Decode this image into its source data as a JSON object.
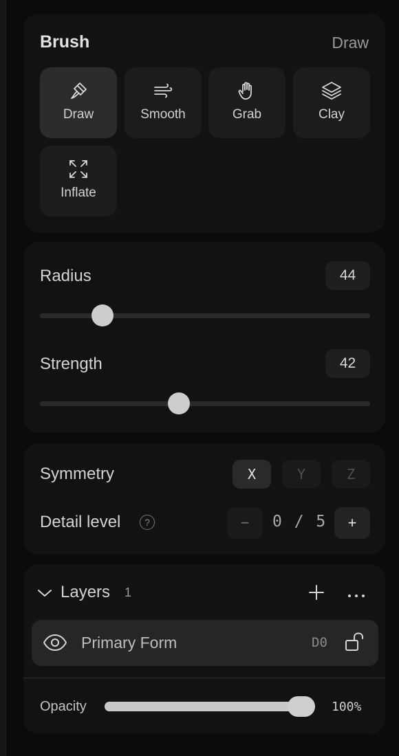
{
  "brush": {
    "title": "Brush",
    "mode": "Draw",
    "tools": [
      {
        "label": "Draw",
        "icon": "brush-icon",
        "active": true
      },
      {
        "label": "Smooth",
        "icon": "wind-icon",
        "active": false
      },
      {
        "label": "Grab",
        "icon": "hand-icon",
        "active": false
      },
      {
        "label": "Clay",
        "icon": "layers-icon",
        "active": false
      },
      {
        "label": "Inflate",
        "icon": "expand-icon",
        "active": false
      }
    ]
  },
  "sliders": {
    "radius": {
      "label": "Radius",
      "value": "44",
      "fraction": 0.19
    },
    "strength": {
      "label": "Strength",
      "value": "42",
      "fraction": 0.42
    }
  },
  "symmetry": {
    "label": "Symmetry",
    "axes": [
      {
        "label": "X",
        "on": true
      },
      {
        "label": "Y",
        "on": false
      },
      {
        "label": "Z",
        "on": false
      }
    ]
  },
  "detail": {
    "label": "Detail level",
    "help": "?",
    "minus": "−",
    "value": "0 / 5",
    "plus": "+"
  },
  "layers": {
    "title": "Layers",
    "count": "1",
    "items": [
      {
        "name": "Primary Form",
        "tag": "D0",
        "visible": true,
        "locked": false
      }
    ],
    "opacity_label": "Opacity",
    "opacity_value": "100%",
    "opacity_fraction": 1.0
  },
  "colors": {
    "background": "#0b0b0b",
    "card": "#121212",
    "active_tool": "#2c2c2c",
    "thumb": "#cdcdcd"
  }
}
